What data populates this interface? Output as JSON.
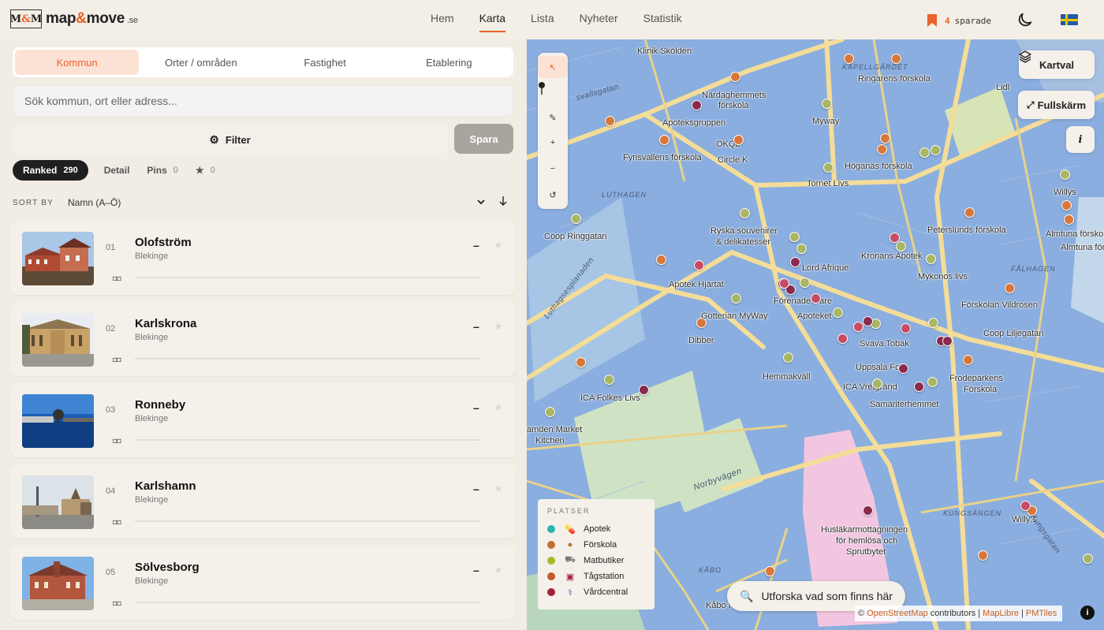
{
  "brand": {
    "mark": "M&M",
    "name_a": "map",
    "name_amp": "&",
    "name_b": "move",
    "tld": ".se"
  },
  "nav": {
    "items": [
      {
        "label": "Hem"
      },
      {
        "label": "Karta"
      },
      {
        "label": "Lista"
      },
      {
        "label": "Nyheter"
      },
      {
        "label": "Statistik"
      }
    ],
    "active": "Karta"
  },
  "saved": {
    "count": "4",
    "label": "sparade"
  },
  "colors": {
    "accent": "#e8622a",
    "map_water": "#8aaedf",
    "panel": "#f1ece4"
  },
  "left": {
    "tabs": [
      {
        "label": "Kommun"
      },
      {
        "label": "Orter / områden"
      },
      {
        "label": "Fastighet"
      },
      {
        "label": "Etablering"
      }
    ],
    "search": {
      "placeholder": "Sök kommun, ort eller adress...",
      "value": ""
    },
    "filter_label": "Filter",
    "save_label": "Spara",
    "views": [
      {
        "label": "Ranked",
        "count": "290"
      },
      {
        "label": "Detail",
        "count": ""
      },
      {
        "label": "Pins",
        "count": "0"
      },
      {
        "label": "★",
        "count": "0"
      }
    ],
    "sort": {
      "label": "SORT BY",
      "value": "Namn (A–Ö)"
    },
    "items": [
      {
        "rank": "01",
        "name": "Olofström",
        "region": "Blekinge",
        "score": "–"
      },
      {
        "rank": "02",
        "name": "Karlskrona",
        "region": "Blekinge",
        "score": "–"
      },
      {
        "rank": "03",
        "name": "Ronneby",
        "region": "Blekinge",
        "score": "–"
      },
      {
        "rank": "04",
        "name": "Karlshamn",
        "region": "Blekinge",
        "score": "–"
      },
      {
        "rank": "05",
        "name": "Sölvesborg",
        "region": "Blekinge",
        "score": "–"
      }
    ]
  },
  "map": {
    "layers_label": "Kartval",
    "fullscreen_label": "Fullskärm",
    "info_label": "i",
    "explore_label": "Utforska vad som finns här",
    "attribution": {
      "prefix": "©",
      "osm": "OpenStreetMap",
      "contributors": "contributors |",
      "maplibre": "MapLibre",
      "sep": "|",
      "pmtiles": "PMTiles"
    },
    "legend": {
      "title": "PLATSER",
      "items": [
        {
          "label": "Apotek",
          "color": "#2bb5b0"
        },
        {
          "label": "Förskola",
          "color": "#c0702e"
        },
        {
          "label": "Matbutiker",
          "color": "#a8b92c"
        },
        {
          "label": "Tågstation",
          "color": "#c25b28"
        },
        {
          "label": "Vårdcentral",
          "color": "#a52038"
        }
      ]
    },
    "labels": [
      "Klinik Skölden",
      "KAPELLGÄRDET",
      "Ringarens förskola",
      "Lidl",
      "Närdaghemmets",
      "förskola",
      "Apoteksgruppen",
      "Myway",
      "OKQ8",
      "Circle K",
      "Fyrisvallens förskola",
      "Höganäs förskola",
      "Tornet Livs",
      "Willys",
      "LUTHAGEN",
      "Coop Ringgatan",
      "Ryska souvenirer",
      "& delikatesser",
      "Peterslunds förskola",
      "Almtuna förskola",
      "Almtuna förs",
      "Kronans Apotek",
      "Lord Afrique",
      "Mykonos livs",
      "FÅLHAGEN",
      "Apotek Hjärtat",
      "Förenade Care",
      "Förskolan Vildrosen",
      "Gotterian MyWay",
      "Apoteket",
      "Coop Liljegatan",
      "Dibber",
      "Svava Tobak",
      "Hemmakväll",
      "Uppsala Fot",
      "Frodeparkens",
      "Förskola",
      "ICA Vretgränd",
      "ICA Folkes Livs",
      "Samariterhemmet",
      "amden Market",
      "Kitchen",
      "Norbyvägen",
      "Luthagsesplanaden",
      "KUNGSÄNGEN",
      "Husläkarmottagningen",
      "för hemlösa och",
      "Sprutbytet",
      "Willy:s",
      "Kungsgatan",
      "KÅBO",
      "Kåbo f",
      "svallsgatan"
    ]
  }
}
